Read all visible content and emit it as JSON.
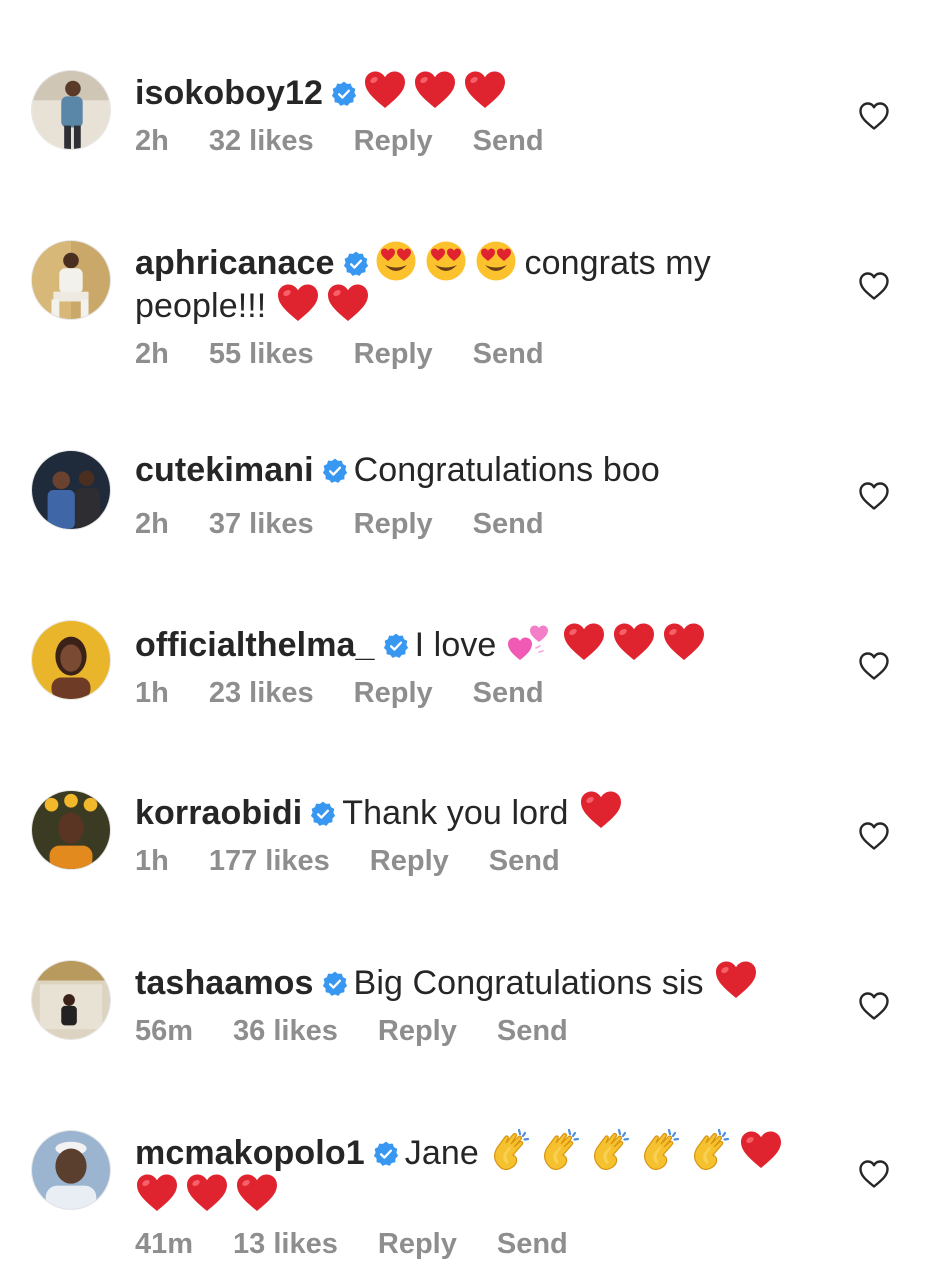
{
  "comments": [
    {
      "username": "isokoboy12",
      "text_before": "",
      "text_after": "",
      "emojis": [
        "red-heart",
        "red-heart",
        "red-heart"
      ],
      "time": "2h",
      "likes": "32 likes",
      "reply": "Reply",
      "send": "Send",
      "avatar_colors": [
        "#d9d3c8",
        "#3a6f8f"
      ]
    },
    {
      "username": "aphricanace",
      "text_before": "",
      "text_after": "congrats my",
      "text_line2": "people!!!",
      "time": "2h",
      "likes": "55 likes",
      "reply": "Reply",
      "send": "Send",
      "avatar_colors": [
        "#c8a86b",
        "#f2f2f0"
      ]
    },
    {
      "username": "cutekimani",
      "text_before": "Congratulations boo",
      "time": "2h",
      "likes": "37 likes",
      "reply": "Reply",
      "send": "Send",
      "avatar_colors": [
        "#2d3c54",
        "#3f67a8"
      ]
    },
    {
      "username": "officialthelma_",
      "text_before": "I love",
      "time": "1h",
      "likes": "23 likes",
      "reply": "Reply",
      "send": "Send",
      "avatar_colors": [
        "#e8b92d",
        "#4a2a1e"
      ]
    },
    {
      "username": "korraobidi",
      "text_before": "Thank you lord",
      "time": "1h",
      "likes": "177 likes",
      "reply": "Reply",
      "send": "Send",
      "avatar_colors": [
        "#3b3a22",
        "#f0b82a"
      ]
    },
    {
      "username": "tashaamos",
      "text_before": "Big Congratulations sis",
      "time": "56m",
      "likes": "36 likes",
      "reply": "Reply",
      "send": "Send",
      "avatar_colors": [
        "#d8d0bf",
        "#222222"
      ]
    },
    {
      "username": "mcmakopolo1",
      "text_before": "Jane",
      "time": "41m",
      "likes": "13 likes",
      "reply": "Reply",
      "send": "Send",
      "avatar_colors": [
        "#8fa9c9",
        "#4f3a2e"
      ]
    }
  ],
  "colors": {
    "verified": "#3897f0",
    "meta_text": "#8e8e8e",
    "heart": "#e0242f",
    "text": "#262626"
  }
}
